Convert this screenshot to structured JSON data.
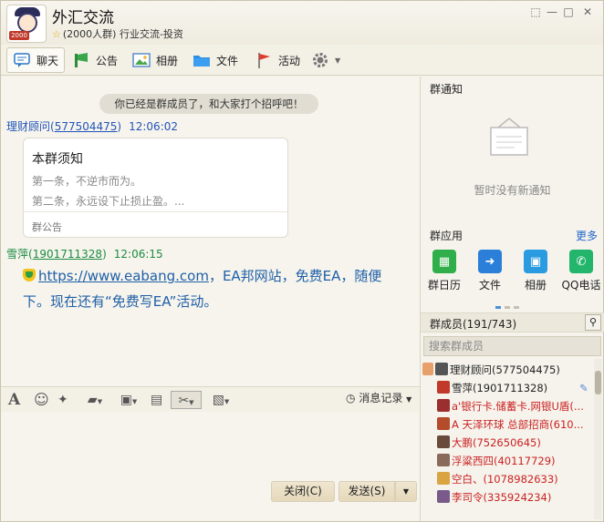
{
  "header": {
    "title": "外汇交流",
    "star": "☆",
    "subtitle": "(2000人群) 行业交流-投资",
    "avatar_badge": "2000"
  },
  "window_controls": {
    "skin": "⬚",
    "minimize": "—",
    "maximize": "□",
    "close": "✕"
  },
  "tabs": [
    {
      "label": "聊天",
      "icon": "chat-bubble-icon"
    },
    {
      "label": "公告",
      "icon": "megaphone-icon"
    },
    {
      "label": "相册",
      "icon": "photo-icon"
    },
    {
      "label": "文件",
      "icon": "folder-icon"
    },
    {
      "label": "活动",
      "icon": "flag-icon"
    },
    {
      "label": "",
      "icon": "gear-icon"
    }
  ],
  "chat": {
    "system_message": "你已经是群成员了，和大家打个招呼吧！",
    "messages": [
      {
        "sender": "理财顾问",
        "id": "577504475",
        "time": "12:06:02"
      },
      {
        "sender": "雪萍",
        "id": "1901711328",
        "time": "12:06:15"
      }
    ],
    "notice_card": {
      "heading": "本群须知",
      "line1": "第一条，不逆市而为。",
      "line2": "第二条，永远设下止损止盈。...",
      "footer": "群公告"
    },
    "message_text": {
      "link": "https://www.eabang.com",
      "rest": "，EA邦网站，免费EA，随便下。现在还有“免费写EA”活动。"
    }
  },
  "input": {
    "history_label": "消息记录",
    "close_label": "关闭(C)",
    "send_label": "发送(S)"
  },
  "right_panel": {
    "notice_title": "群通知",
    "no_notice": "暂时没有新通知",
    "apps_title": "群应用",
    "more": "更多",
    "apps": [
      {
        "label": "群日历",
        "color": "#2fae4a",
        "glyph": "▦"
      },
      {
        "label": "文件",
        "color": "#2b7fd8",
        "glyph": "➜"
      },
      {
        "label": "相册",
        "color": "#2a9be0",
        "glyph": "▣"
      },
      {
        "label": "QQ电话",
        "color": "#22b56b",
        "glyph": "✆"
      }
    ],
    "members_title": "群成员(191/743)",
    "search_placeholder": "搜索群成员",
    "members": [
      {
        "name": "理财顾问(577504475)",
        "color": "#222222"
      },
      {
        "name": "雪萍(1901711328)",
        "color": "#222222"
      },
      {
        "name": "a'银行卡.储蓄卡.网银U盾(...",
        "color": "#cc2222"
      },
      {
        "name": "A 天泽环球 总部招商(610...",
        "color": "#cc2222"
      },
      {
        "name": "大鹏(752650645)",
        "color": "#cc2222"
      },
      {
        "name": "浮粱西四(40117729)",
        "color": "#cc2222"
      },
      {
        "name": "空白、(1078982633)",
        "color": "#cc2222"
      },
      {
        "name": "李司令(335924234)",
        "color": "#cc2222"
      }
    ]
  }
}
